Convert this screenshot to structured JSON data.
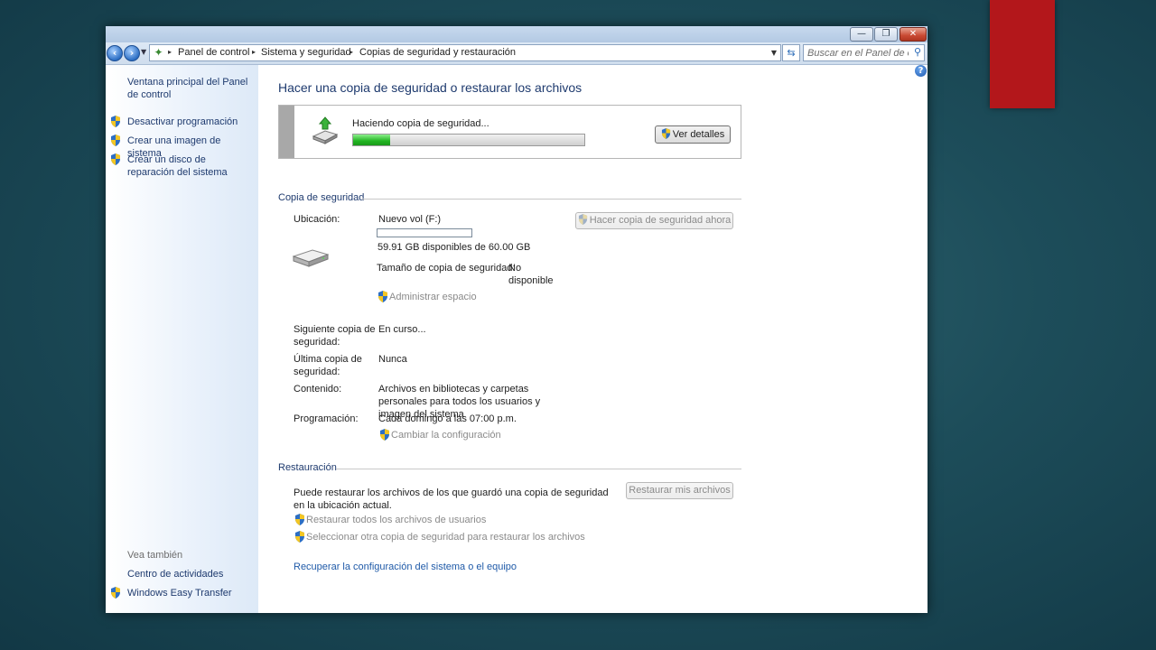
{
  "window": {
    "controls": {
      "minimize": "—",
      "maximize": "❐",
      "close": "✕"
    }
  },
  "address_bar": {
    "breadcrumbs": [
      "Panel de control",
      "Sistema y seguridad",
      "Copias de seguridad y restauración"
    ],
    "search_placeholder": "Buscar en el Panel de c..."
  },
  "sidebar": {
    "home_link": "Ventana principal del Panel de control",
    "tasks": [
      "Desactivar programación",
      "Crear una imagen de sistema",
      "Crear un disco de reparación del sistema"
    ],
    "see_also_title": "Vea también",
    "see_also": [
      "Centro de actividades",
      "Windows Easy Transfer"
    ]
  },
  "main": {
    "title": "Hacer una copia de seguridad o restaurar los archivos",
    "progress": {
      "status": "Haciendo copia de seguridad...",
      "fraction": 0.16,
      "details_button": "Ver detalles"
    },
    "backup_section": {
      "title": "Copia de seguridad",
      "location_label": "Ubicación:",
      "location_value": "Nuevo vol (F:)",
      "space_available": "59.91 GB disponibles de 60.00 GB",
      "size_label": "Tamaño de copia de seguridad:",
      "size_value": "No disponible",
      "manage_space_link": "Administrar espacio",
      "backup_now_button": "Hacer copia de seguridad ahora",
      "next_label": "Siguiente copia de seguridad:",
      "next_value": "En curso...",
      "last_label": "Última copia de seguridad:",
      "last_value": "Nunca",
      "contents_label": "Contenido:",
      "contents_value": "Archivos en bibliotecas y carpetas personales para todos los usuarios y imagen del sistema",
      "schedule_label": "Programación:",
      "schedule_value": "Cada domingo a las 07:00 p.m.",
      "change_settings_link": "Cambiar la configuración"
    },
    "restore_section": {
      "title": "Restauración",
      "description": "Puede restaurar los archivos de los que guardó una copia de seguridad en la ubicación actual.",
      "restore_button": "Restaurar mis archivos",
      "restore_all_link": "Restaurar todos los archivos de usuarios",
      "select_other_link": "Seleccionar otra copia de seguridad para restaurar los archivos",
      "recover_link": "Recuperar la configuración del sistema o el equipo"
    }
  },
  "colors": {
    "progress_fill": "#22b422",
    "link_blue": "#1f5aa8",
    "title_blue": "#1e3a6e",
    "desktop_red_block": "#b3171b"
  }
}
